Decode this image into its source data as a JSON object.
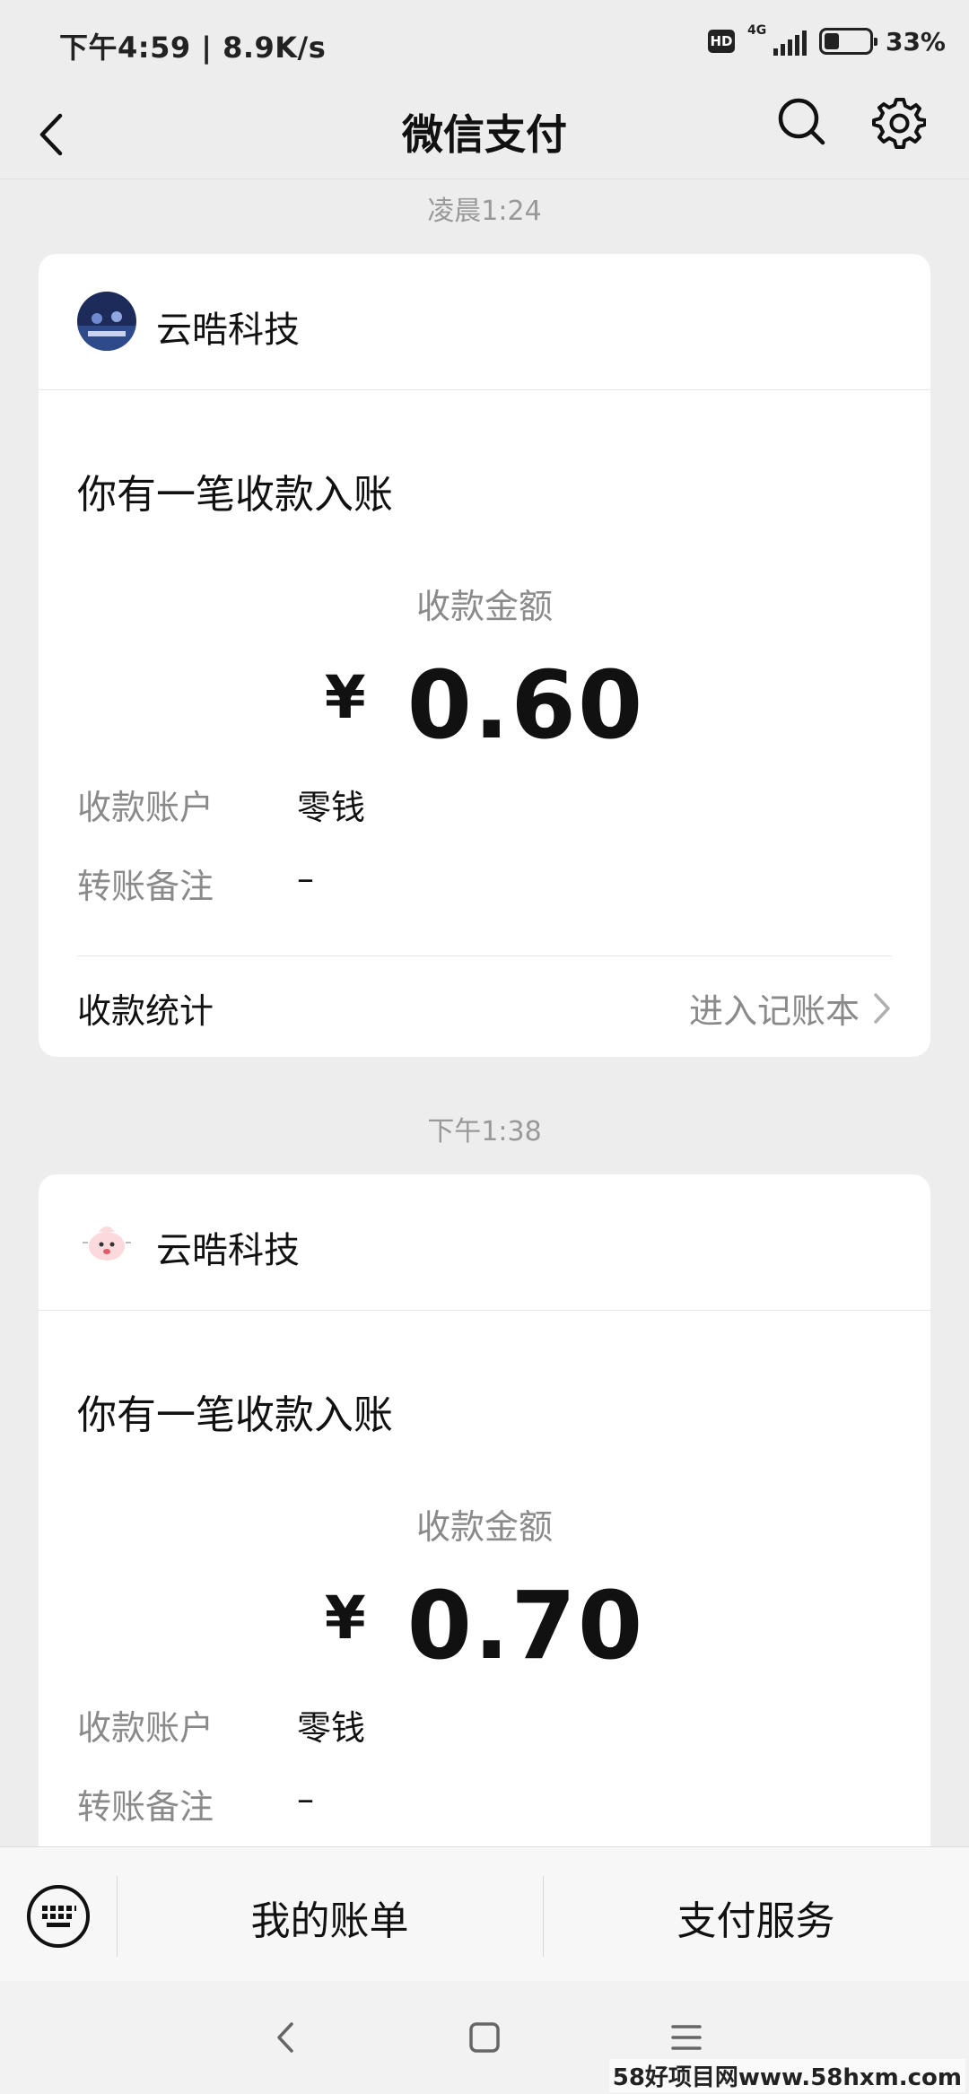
{
  "status_bar": {
    "time_speed": "下午4:59 | 8.9K/s",
    "hd_badge": "HD",
    "network": "4G",
    "battery_text": "33%",
    "battery_level": 0.33
  },
  "nav": {
    "title": "微信支付",
    "back_icon": "chevron-left-icon",
    "search_icon": "search-icon",
    "settings_icon": "gear-icon"
  },
  "messages": [
    {
      "time": "凌晨1:24",
      "merchant": "云晧科技",
      "headline": "你有一笔收款入账",
      "amount_label": "收款金额",
      "currency": "¥",
      "amount": "0.60",
      "account_label": "收款账户",
      "account_value": "零钱",
      "remark_label": "转账备注",
      "remark_value": "–",
      "footer_left": "收款统计",
      "footer_right": "进入记账本"
    },
    {
      "time": "下午1:38",
      "merchant": "云晧科技",
      "headline": "你有一笔收款入账",
      "amount_label": "收款金额",
      "currency": "¥",
      "amount": "0.70",
      "account_label": "收款账户",
      "account_value": "零钱",
      "remark_label": "转账备注",
      "remark_value": "–"
    }
  ],
  "bottom_menu": {
    "keyboard_icon": "keyboard-icon",
    "item1": "我的账单",
    "item2": "支付服务"
  },
  "system_nav": {
    "back_icon": "back-icon",
    "home_icon": "home-icon",
    "menu_icon": "menu-icon"
  },
  "watermark": "58好项目网www.58hxm.com",
  "colors": {
    "background": "#ededed",
    "card": "#ffffff",
    "muted_text": "#8a8a8a"
  }
}
